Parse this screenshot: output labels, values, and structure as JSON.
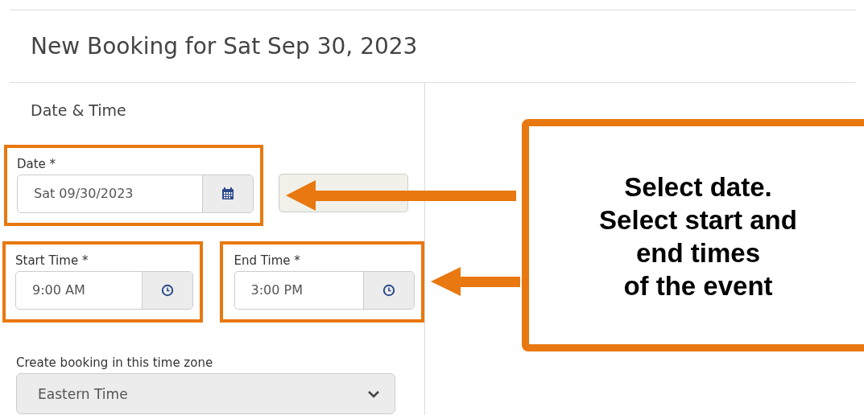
{
  "title": "New Booking for Sat Sep 30, 2023",
  "section": "Date & Time",
  "field_rows": [
    [
      {
        "kind": "date",
        "label": "Date *",
        "value": "Sat 09/30/2023",
        "highlighted": true
      }
    ],
    [
      {
        "kind": "time",
        "label": "Start Time *",
        "value": "9:00 AM",
        "highlighted": true
      },
      {
        "kind": "time",
        "label": "End Time *",
        "value": "3:00 PM",
        "highlighted": true
      }
    ]
  ],
  "timezone": {
    "label": "Create booking in this time zone",
    "value": "Eastern Time"
  },
  "callout": {
    "text": "Select date.\nSelect start and\nend times\nof the event"
  }
}
